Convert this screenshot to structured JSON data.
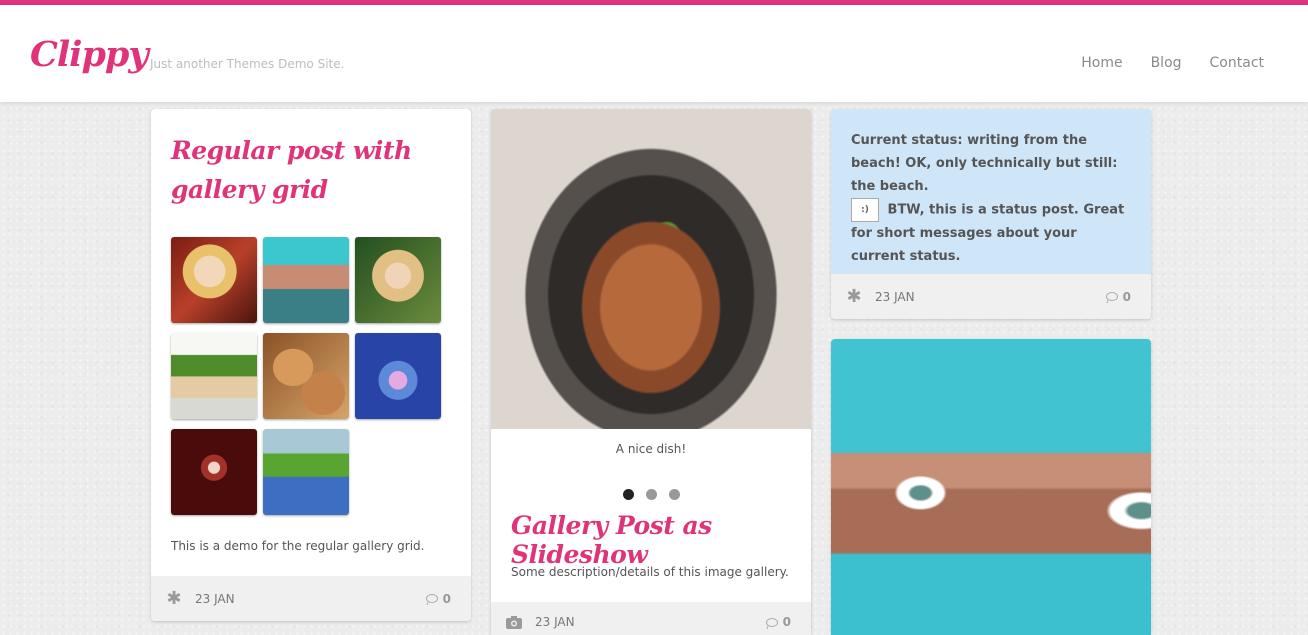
{
  "site": {
    "logo": "Clippy",
    "tagline": "Just another Themes Demo Site.",
    "accent": "#e0347a"
  },
  "nav": {
    "home": "Home",
    "blog": "Blog",
    "contact": "Contact"
  },
  "post_gallery_grid": {
    "title": "Regular post with gallery grid",
    "thumbnails": [
      "portrait-blonde",
      "turquoise-veil-eyes",
      "girl-with-tiara",
      "sushi-bento",
      "bread-rolls",
      "water-drop",
      "disco-ball",
      "track-runners"
    ],
    "description": "This is a demo for the regular gallery grid.",
    "footer": {
      "format_icon": "asterisk-icon",
      "date": "23 JAN",
      "comments": "0"
    }
  },
  "post_slideshow": {
    "image": "dish-pot",
    "caption": "A nice dish!",
    "slides": 3,
    "active_slide": 1,
    "title": "Gallery Post as Slideshow",
    "description": "Some description/details of this image gallery.",
    "footer": {
      "format_icon": "camera-icon",
      "date": "23 JAN",
      "comments": "0"
    }
  },
  "post_status": {
    "line1": "Current status: writing from the beach! OK, only technically but still: the beach.",
    "broken_image_alt": ":)",
    "line2": "BTW, this is a status post. Great for short messages about your current status.",
    "background": "#cfe6f9",
    "footer": {
      "format_icon": "asterisk-icon",
      "date": "23 JAN",
      "comments": "0"
    }
  },
  "post_image": {
    "image": "turquoise-veil-eyes"
  }
}
